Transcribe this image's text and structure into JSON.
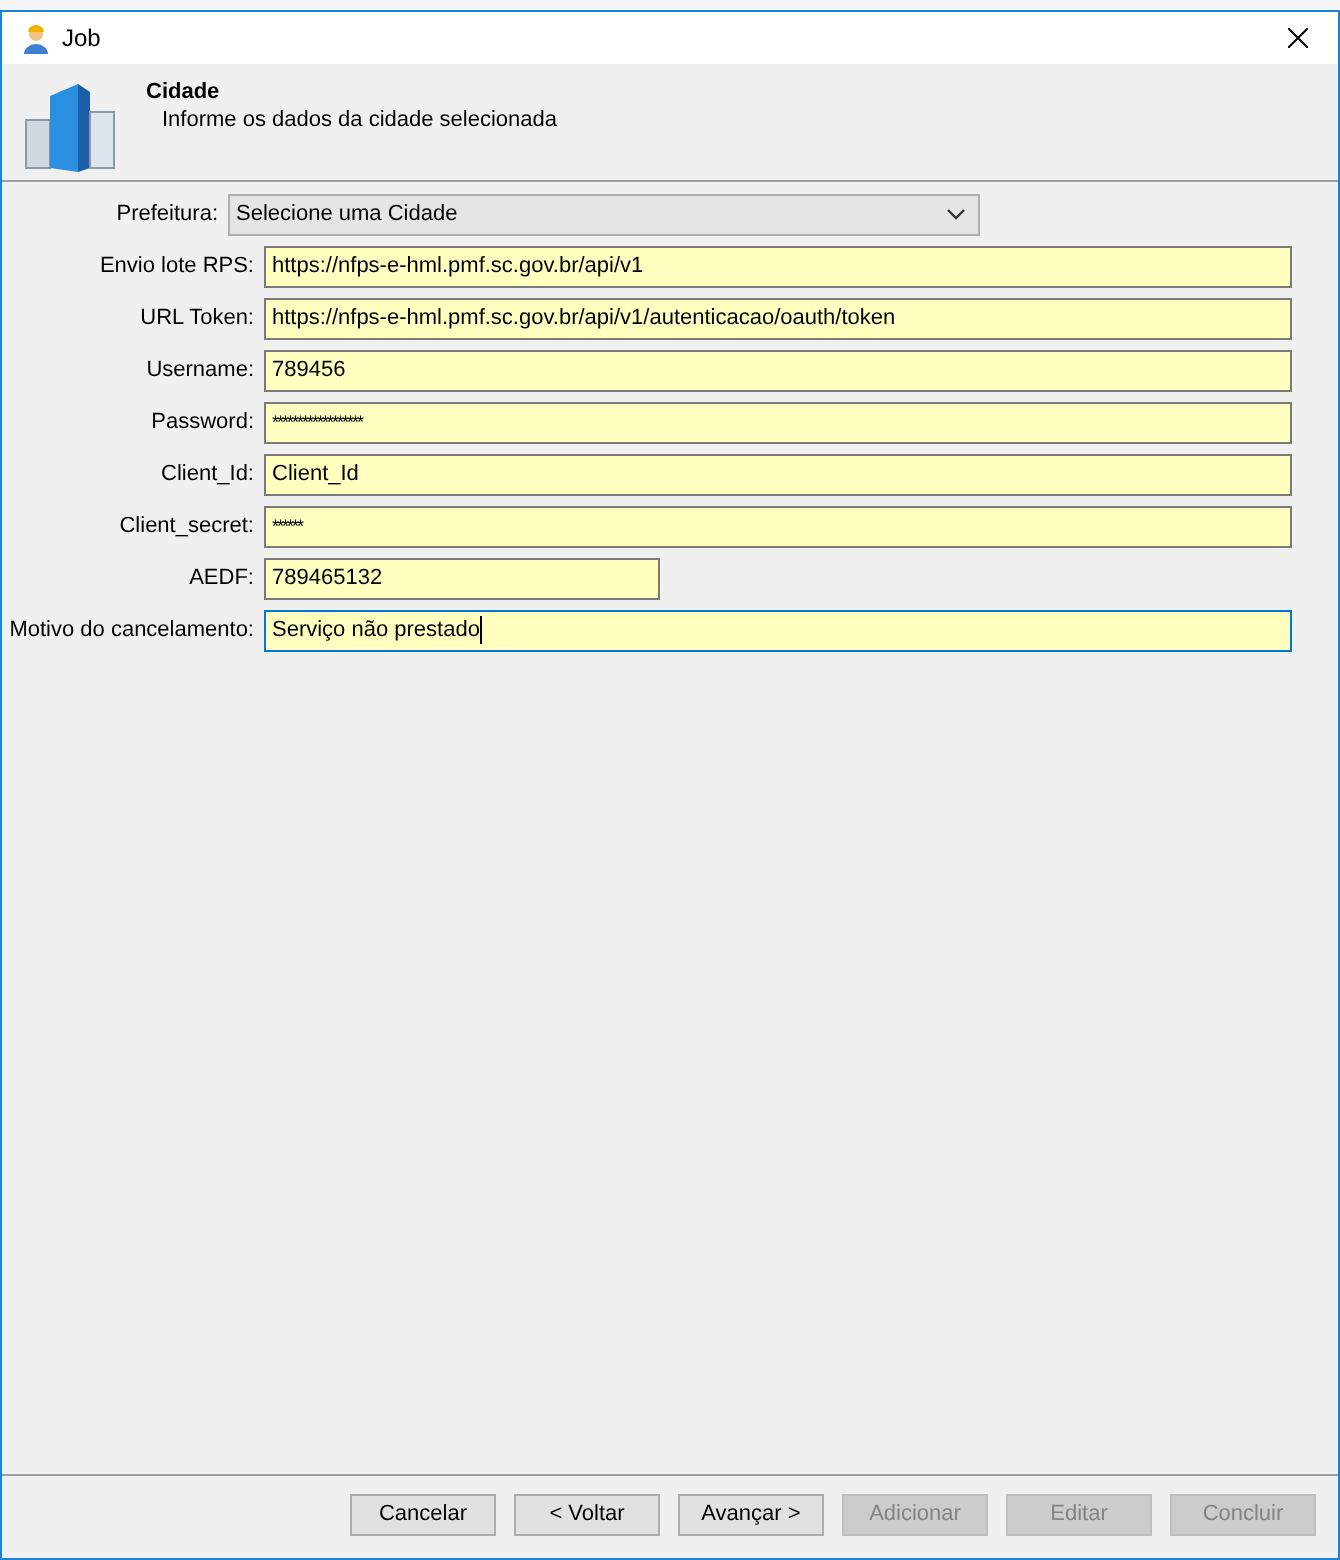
{
  "window": {
    "title": "Job"
  },
  "header": {
    "title": "Cidade",
    "subtitle": "Informe os dados da cidade selecionada"
  },
  "fields": [
    {
      "kind": "dropdown",
      "label": "Prefeitura:",
      "value": "Selecione uma Cidade",
      "focused": false
    },
    {
      "kind": "text",
      "label": "Envio lote RPS:",
      "value": "https://nfps-e-hml.pmf.sc.gov.br/api/v1",
      "focused": false
    },
    {
      "kind": "text",
      "label": "URL  Token:",
      "value": "https://nfps-e-hml.pmf.sc.gov.br/api/v1/autenticacao/oauth/token",
      "focused": false
    },
    {
      "kind": "text",
      "label": "Username:",
      "value": "789456",
      "focused": false
    },
    {
      "kind": "password",
      "label": "Password:",
      "value": "******************",
      "focused": false
    },
    {
      "kind": "text",
      "label": "Client_Id:",
      "value": "Client_Id",
      "focused": false
    },
    {
      "kind": "password",
      "label": "Client_secret:",
      "value": "******",
      "focused": false
    },
    {
      "kind": "short",
      "label": "AEDF:",
      "value": "789465132",
      "focused": false
    },
    {
      "kind": "text",
      "label": "Motivo do cancelamento:",
      "value": "Serviço não prestado",
      "focused": true
    }
  ],
  "buttons": [
    {
      "label": "Cancelar",
      "disabled": false
    },
    {
      "label": "< Voltar",
      "disabled": false
    },
    {
      "label": "Avançar >",
      "disabled": false
    },
    {
      "label": "Adicionar",
      "disabled": true
    },
    {
      "label": "Editar",
      "disabled": true
    },
    {
      "label": "Concluir",
      "disabled": true
    }
  ]
}
